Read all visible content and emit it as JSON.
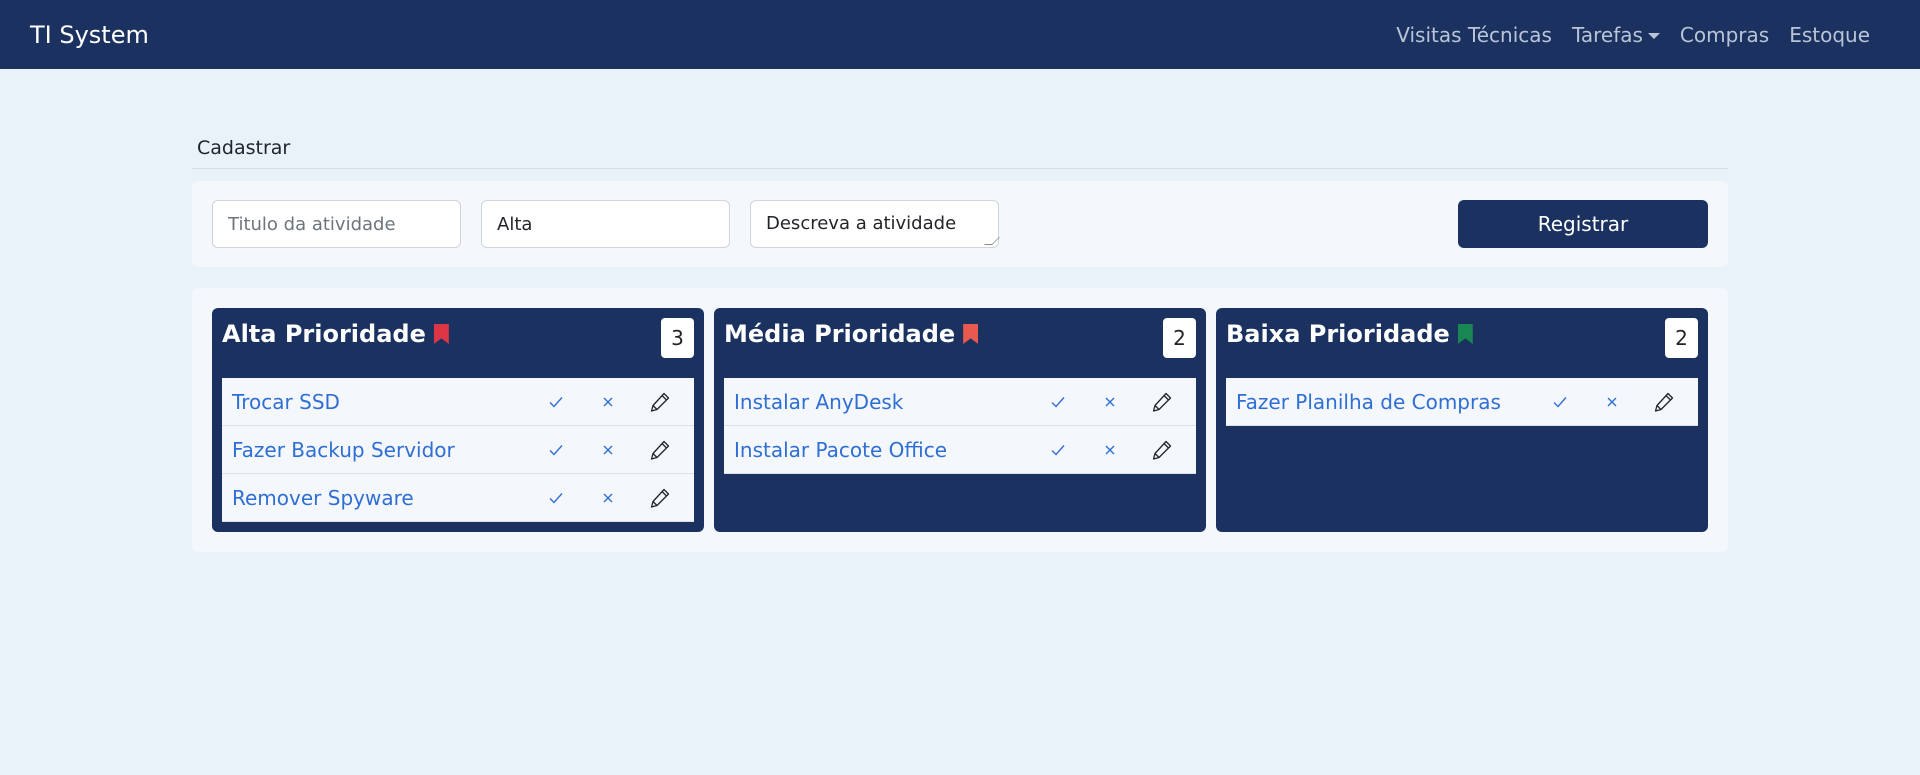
{
  "app": {
    "brand": "TI System",
    "nav": [
      {
        "label": "Visitas Técnicas"
      },
      {
        "label": "Tarefas",
        "dropdown": true
      },
      {
        "label": "Compras"
      },
      {
        "label": "Estoque"
      }
    ]
  },
  "form": {
    "section_title": "Cadastrar",
    "title_placeholder": "Titulo da atividade",
    "title_value": "",
    "priority_value": "Alta",
    "description_value": "Descreva a atividade",
    "register_label": "Registrar"
  },
  "columns": [
    {
      "title": "Alta Prioridade",
      "count": "3",
      "bookmark_color": "#dc3545",
      "tasks": [
        {
          "title": "Trocar SSD"
        },
        {
          "title": "Fazer Backup Servidor"
        },
        {
          "title": "Remover Spyware"
        }
      ]
    },
    {
      "title": "Média Prioridade",
      "count": "2",
      "bookmark_color": "#e8594f",
      "tasks": [
        {
          "title": "Instalar AnyDesk"
        },
        {
          "title": "Instalar Pacote Office"
        }
      ]
    },
    {
      "title": "Baixa Prioridade",
      "count": "2",
      "bookmark_color": "#198754",
      "tasks": [
        {
          "title": "Fazer Planilha de Compras"
        }
      ]
    }
  ],
  "icons": {
    "done": "check-icon",
    "remove": "close-icon",
    "edit": "pencil-icon",
    "priority": "bookmark-icon"
  },
  "colors": {
    "navbar": "#1b3260",
    "page": "#e9f1f9",
    "link": "#2f6fd4",
    "action": "#2f6fd4"
  }
}
